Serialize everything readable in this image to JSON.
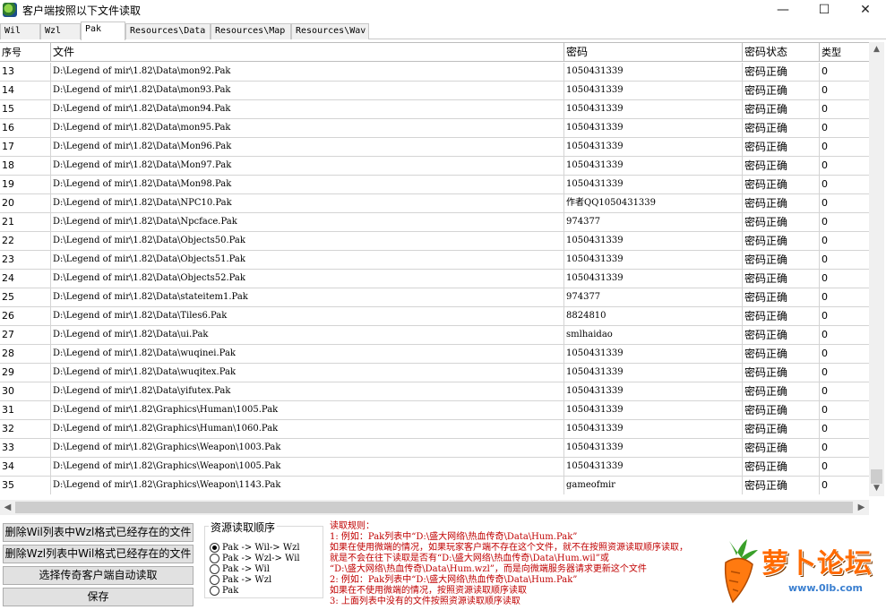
{
  "window": {
    "title": "客户端按照以下文件读取",
    "minimize": "—",
    "maximize": "☐",
    "close": "✕"
  },
  "tabs": [
    {
      "label": "Wil"
    },
    {
      "label": "Wzl"
    },
    {
      "label": "Pak"
    },
    {
      "label": "Resources\\Data"
    },
    {
      "label": "Resources\\Map"
    },
    {
      "label": "Resources\\Wav"
    }
  ],
  "grid": {
    "columns": [
      "序号",
      "文件",
      "密码",
      "密码状态",
      "类型"
    ],
    "rows": [
      {
        "no": "13",
        "file": "D:\\Legend of mir\\1.82\\Data\\mon92.Pak",
        "password": "1050431339",
        "status": "密码正确",
        "type": "0"
      },
      {
        "no": "14",
        "file": "D:\\Legend of mir\\1.82\\Data\\mon93.Pak",
        "password": "1050431339",
        "status": "密码正确",
        "type": "0"
      },
      {
        "no": "15",
        "file": "D:\\Legend of mir\\1.82\\Data\\mon94.Pak",
        "password": "1050431339",
        "status": "密码正确",
        "type": "0"
      },
      {
        "no": "16",
        "file": "D:\\Legend of mir\\1.82\\Data\\mon95.Pak",
        "password": "1050431339",
        "status": "密码正确",
        "type": "0"
      },
      {
        "no": "17",
        "file": "D:\\Legend of mir\\1.82\\Data\\Mon96.Pak",
        "password": "1050431339",
        "status": "密码正确",
        "type": "0"
      },
      {
        "no": "18",
        "file": "D:\\Legend of mir\\1.82\\Data\\Mon97.Pak",
        "password": "1050431339",
        "status": "密码正确",
        "type": "0"
      },
      {
        "no": "19",
        "file": "D:\\Legend of mir\\1.82\\Data\\Mon98.Pak",
        "password": "1050431339",
        "status": "密码正确",
        "type": "0"
      },
      {
        "no": "20",
        "file": "D:\\Legend of mir\\1.82\\Data\\NPC10.Pak",
        "password": "作者QQ1050431339",
        "status": "密码正确",
        "type": "0"
      },
      {
        "no": "21",
        "file": "D:\\Legend of mir\\1.82\\Data\\Npcface.Pak",
        "password": "974377",
        "status": "密码正确",
        "type": "0"
      },
      {
        "no": "22",
        "file": "D:\\Legend of mir\\1.82\\Data\\Objects50.Pak",
        "password": "1050431339",
        "status": "密码正确",
        "type": "0"
      },
      {
        "no": "23",
        "file": "D:\\Legend of mir\\1.82\\Data\\Objects51.Pak",
        "password": "1050431339",
        "status": "密码正确",
        "type": "0"
      },
      {
        "no": "24",
        "file": "D:\\Legend of mir\\1.82\\Data\\Objects52.Pak",
        "password": "1050431339",
        "status": "密码正确",
        "type": "0"
      },
      {
        "no": "25",
        "file": "D:\\Legend of mir\\1.82\\Data\\stateitem1.Pak",
        "password": "974377",
        "status": "密码正确",
        "type": "0"
      },
      {
        "no": "26",
        "file": "D:\\Legend of mir\\1.82\\Data\\Tiles6.Pak",
        "password": "8824810",
        "status": "密码正确",
        "type": "0"
      },
      {
        "no": "27",
        "file": "D:\\Legend of mir\\1.82\\Data\\ui.Pak",
        "password": "smlhaidao",
        "status": "密码正确",
        "type": "0"
      },
      {
        "no": "28",
        "file": "D:\\Legend of mir\\1.82\\Data\\wuqinei.Pak",
        "password": "1050431339",
        "status": "密码正确",
        "type": "0"
      },
      {
        "no": "29",
        "file": "D:\\Legend of mir\\1.82\\Data\\wuqitex.Pak",
        "password": "1050431339",
        "status": "密码正确",
        "type": "0"
      },
      {
        "no": "30",
        "file": "D:\\Legend of mir\\1.82\\Data\\yifutex.Pak",
        "password": "1050431339",
        "status": "密码正确",
        "type": "0"
      },
      {
        "no": "31",
        "file": "D:\\Legend of mir\\1.82\\Graphics\\Human\\1005.Pak",
        "password": "1050431339",
        "status": "密码正确",
        "type": "0"
      },
      {
        "no": "32",
        "file": "D:\\Legend of mir\\1.82\\Graphics\\Human\\1060.Pak",
        "password": "1050431339",
        "status": "密码正确",
        "type": "0"
      },
      {
        "no": "33",
        "file": "D:\\Legend of mir\\1.82\\Graphics\\Weapon\\1003.Pak",
        "password": "1050431339",
        "status": "密码正确",
        "type": "0"
      },
      {
        "no": "34",
        "file": "D:\\Legend of mir\\1.82\\Graphics\\Weapon\\1005.Pak",
        "password": "1050431339",
        "status": "密码正确",
        "type": "0"
      },
      {
        "no": "35",
        "file": "D:\\Legend of mir\\1.82\\Graphics\\Weapon\\1143.Pak",
        "password": "gameofmir",
        "status": "密码正确",
        "type": "0"
      }
    ]
  },
  "buttons": {
    "delete_wil": "删除Wil列表中Wzl格式已经存在的文件",
    "delete_wzl": "删除Wzl列表中Wil格式已经存在的文件",
    "auto_read": "选择传奇客户端自动读取",
    "save": "保存"
  },
  "read_order": {
    "title": "资源读取顺序",
    "options": [
      {
        "label": "Pak -> Wil-> Wzl",
        "checked": true
      },
      {
        "label": "Pak -> Wzl-> Wil",
        "checked": false
      },
      {
        "label": "Pak -> Wil",
        "checked": false
      },
      {
        "label": "Pak -> Wzl",
        "checked": false
      },
      {
        "label": "Pak",
        "checked": false
      }
    ]
  },
  "rules": {
    "lines": [
      "读取规则：",
      "1: 例如：Pak列表中“D:\\盛大网络\\热血传奇\\Data\\Hum.Pak”",
      "   如果在使用微端的情况，如果玩家客户端不存在这个文件，就不在按照资源读取顺序读取，",
      "   就是不会在往下读取是否有“D:\\盛大网络\\热血传奇\\Data\\Hum.wil”或",
      "  “D:\\盛大网络\\热血传奇\\Data\\Hum.wzl”，而是向微端服务器请求更新这个文件",
      "2: 例如：Pak列表中“D:\\盛大网络\\热血传奇\\Data\\Hum.Pak”",
      "   如果在不使用微端的情况，按照资源读取顺序读取",
      "3: 上面列表中没有的文件按照资源读取顺序读取"
    ]
  },
  "watermark": {
    "text": "萝卜论坛",
    "url": "www.0lb.com"
  },
  "colors": {
    "rules_text": "#c00000",
    "logo": "#ff6a00"
  }
}
